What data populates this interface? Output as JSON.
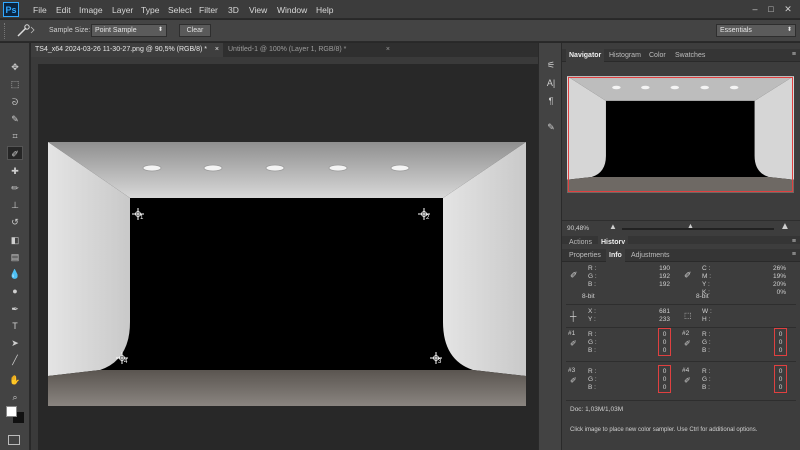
{
  "app": {
    "logo": "Ps"
  },
  "menu": [
    "File",
    "Edit",
    "Image",
    "Layer",
    "Type",
    "Select",
    "Filter",
    "3D",
    "View",
    "Window",
    "Help"
  ],
  "window_controls": [
    "–",
    "□",
    "✕"
  ],
  "options": {
    "sample_size_label": "Sample Size:",
    "sample_size_value": "Point Sample",
    "clear_label": "Clear",
    "workspace": "Essentials"
  },
  "documents": {
    "tabs": [
      {
        "label": "TS4_x64 2024-03-26 11-30-27.png @ 90,5% (RGB/8) *",
        "active": true
      },
      {
        "label": "Untitled-1 @ 100% (Layer 1, RGB/8) *",
        "active": false
      }
    ]
  },
  "samplers": [
    "1",
    "2",
    "3",
    "4"
  ],
  "navigator": {
    "tabs": [
      "Navigator",
      "Histogram",
      "Color",
      "Swatches"
    ],
    "zoom": "90,48%"
  },
  "history_panel": {
    "tabs": [
      "Actions",
      "History"
    ]
  },
  "info_panel": {
    "tabs": [
      "Properties",
      "Info",
      "Adjustments"
    ],
    "rgb": {
      "r_label": "R :",
      "g_label": "G :",
      "b_label": "B :",
      "r": "190",
      "g": "192",
      "b": "192"
    },
    "cmyk": {
      "c_label": "C :",
      "m_label": "M :",
      "y_label": "Y :",
      "k_label": "K :",
      "c": "26%",
      "m": "19%",
      "y": "20%",
      "k": "0%"
    },
    "bit_depth_left": "8-bit",
    "bit_depth_right": "8-bit",
    "xy": {
      "x_label": "X :",
      "y_label": "Y :",
      "x": "681",
      "y": "233"
    },
    "wh": {
      "w_label": "W :",
      "h_label": "H :"
    },
    "samplers": [
      {
        "id": "#1",
        "r": "0",
        "g": "0",
        "b": "0"
      },
      {
        "id": "#2",
        "r": "0",
        "g": "0",
        "b": "0"
      },
      {
        "id": "#3",
        "r": "0",
        "g": "0",
        "b": "0"
      },
      {
        "id": "#4",
        "r": "0",
        "g": "0",
        "b": "0"
      }
    ],
    "doc": "Doc: 1,03M/1,03M",
    "hint": "Click image to place new color sampler.  Use Ctrl for additional options."
  },
  "colors": {
    "accent_red": "#e04040",
    "bg_dark": "#282828",
    "panel": "#3d3d3d"
  }
}
